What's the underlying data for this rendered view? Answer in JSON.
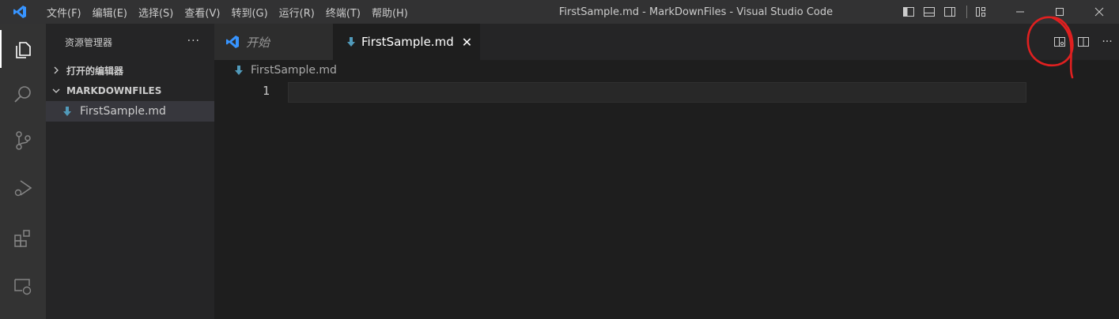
{
  "titlebar": {
    "menu": [
      "文件(F)",
      "编辑(E)",
      "选择(S)",
      "查看(V)",
      "转到(G)",
      "运行(R)",
      "终端(T)",
      "帮助(H)"
    ],
    "window_title": "FirstSample.md - MarkDownFiles - Visual Studio Code"
  },
  "icons": {
    "app": "vscode-logo-icon",
    "activity": [
      "explorer-icon",
      "search-icon",
      "source-control-icon",
      "run-debug-icon",
      "extensions-icon",
      "remote-explorer-icon"
    ],
    "layout": [
      "toggle-primary-sidebar-icon",
      "toggle-panel-icon",
      "toggle-secondary-sidebar-icon",
      "customize-layout-icon"
    ],
    "window": [
      "minimize-icon",
      "maximize-icon",
      "close-icon"
    ],
    "editor_actions": [
      "open-preview-to-side-icon",
      "split-editor-icon",
      "more-actions-icon"
    ]
  },
  "sidebar": {
    "title": "资源管理器",
    "more": "···",
    "open_editors": "打开的编辑器",
    "folder": "MARKDOWNFILES",
    "file": "FirstSample.md"
  },
  "tabs": [
    {
      "label": "开始",
      "active": false
    },
    {
      "label": "FirstSample.md",
      "active": true
    }
  ],
  "tab_close": "✕",
  "tab_more": "···",
  "editor": {
    "breadcrumb": "FirstSample.md",
    "line_number": "1"
  },
  "colors": {
    "accent": "#3794ff",
    "markdown_icon": "#519aba",
    "annotation": "#e02020"
  }
}
